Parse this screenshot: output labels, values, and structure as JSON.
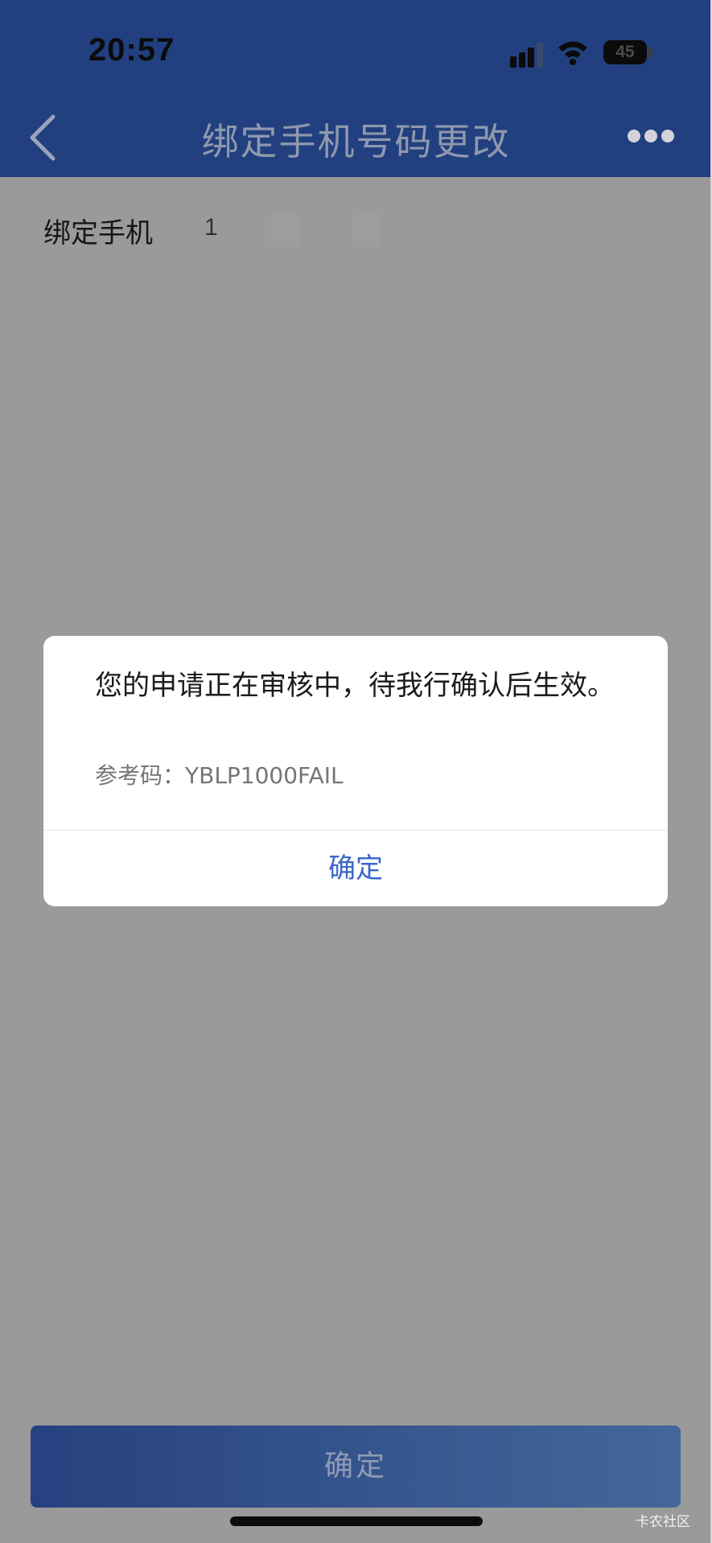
{
  "status_bar": {
    "time": "20:57",
    "battery_level": "45"
  },
  "nav": {
    "title": "绑定手机号码更改"
  },
  "form": {
    "bound_phone_label": "绑定手机",
    "bound_phone_value": "1"
  },
  "dialog": {
    "message": "您的申请正在审核中，待我行确认后生效。",
    "reference": "参考码：YBLP1000FAIL",
    "confirm_label": "确定"
  },
  "footer": {
    "confirm_label": "确定"
  },
  "watermark": "卡农社区",
  "colors": {
    "header_bg": "#22407f",
    "overlay_bg": "#9a9a9a",
    "accent": "#3a66c9"
  }
}
